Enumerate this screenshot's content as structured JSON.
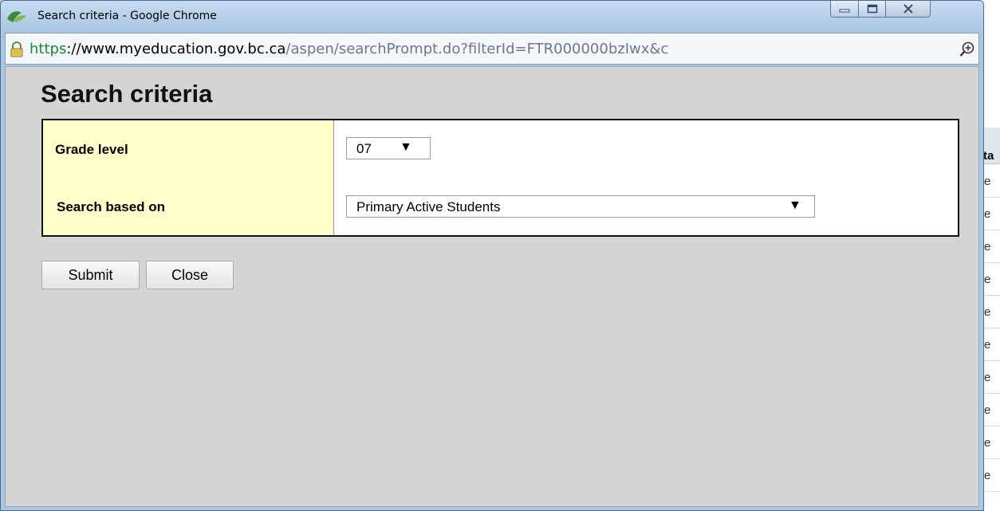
{
  "window": {
    "title": "Search criteria - Google Chrome",
    "controls": {
      "minimize": "minimize",
      "maximize": "maximize",
      "close": "close"
    }
  },
  "address_bar": {
    "scheme": "https",
    "separator": "://",
    "host": "www.myeducation.gov.bc.ca",
    "path": "/aspen/searchPrompt.do?filterId=FTR000000bzIwx&c",
    "icons": {
      "lock": "lock-icon",
      "zoom": "zoom-icon"
    }
  },
  "page": {
    "title": "Search criteria",
    "fields": {
      "grade_level": {
        "label": "Grade level",
        "selected": "07"
      },
      "search_based_on": {
        "label": "Search based on",
        "selected": "Primary Active Students"
      }
    },
    "dropdown_arrow": "▼",
    "buttons": {
      "submit": "Submit",
      "close": "Close"
    }
  },
  "background_page": {
    "header": "ta",
    "row_text": "e",
    "rows": [
      "e",
      "e",
      "e",
      "e",
      "e",
      "e",
      "e",
      "e",
      "e",
      "e"
    ]
  },
  "colors": {
    "label_background": "#ffffcc",
    "content_background": "#d4d4d4",
    "url_scheme": "#1a8c2c",
    "window_frame": "#a9c6e4"
  }
}
